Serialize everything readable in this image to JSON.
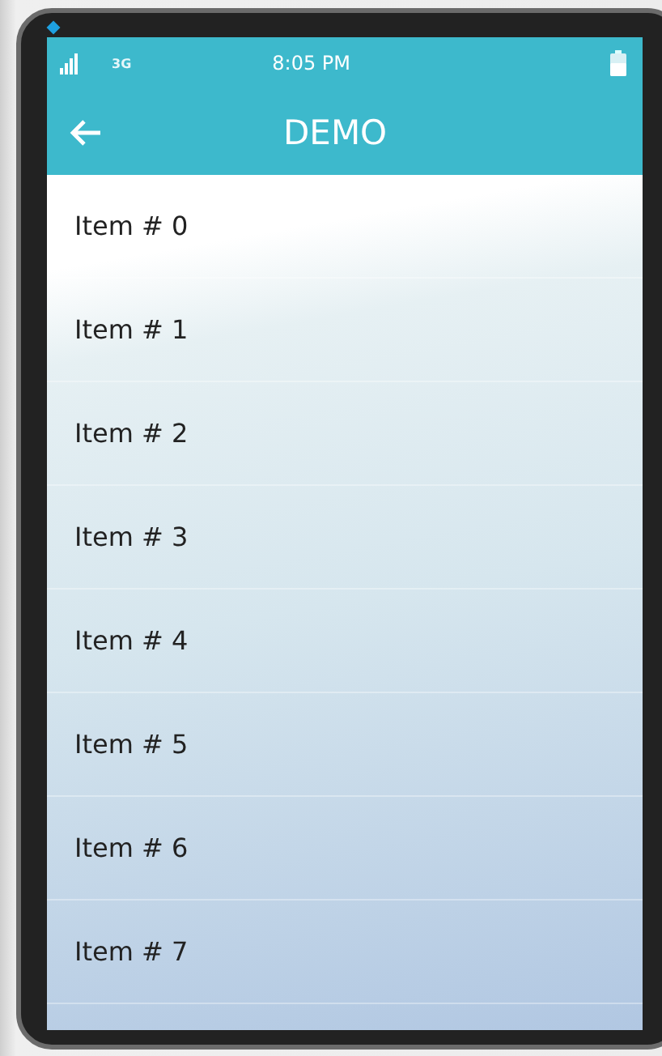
{
  "status_bar": {
    "network": "3G",
    "time": "8:05 PM"
  },
  "app_bar": {
    "title": "DEMO"
  },
  "items": [
    {
      "label": "Item # 0"
    },
    {
      "label": "Item # 1"
    },
    {
      "label": "Item # 2"
    },
    {
      "label": "Item # 3"
    },
    {
      "label": "Item # 4"
    },
    {
      "label": "Item # 5"
    },
    {
      "label": "Item # 6"
    },
    {
      "label": "Item # 7"
    }
  ]
}
